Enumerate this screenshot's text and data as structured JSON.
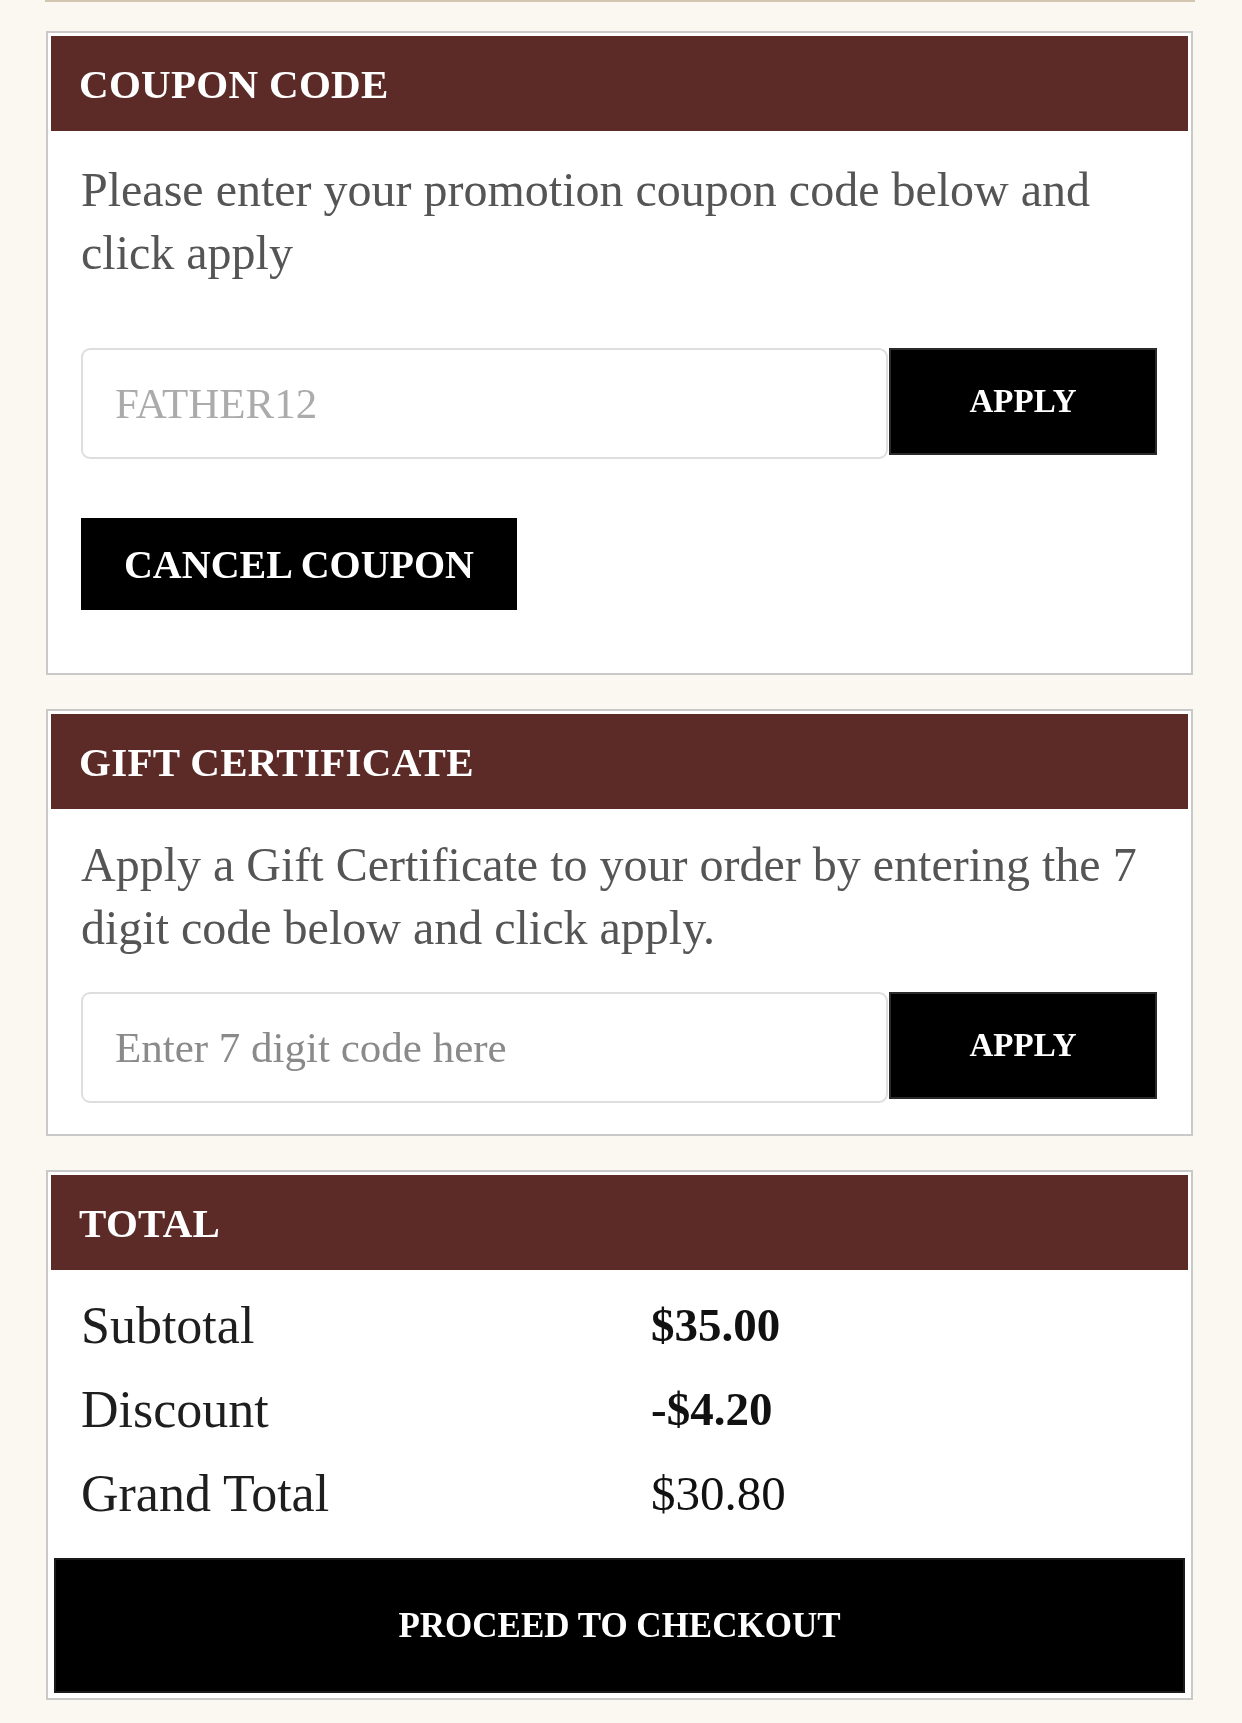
{
  "coupon_code": {
    "title": "COUPON CODE",
    "text": "Please enter your promotion coupon code below and click apply",
    "input": {
      "value": "FATHER12",
      "disabled": true
    },
    "apply_button": "APPLY",
    "cancel_button": "CANCEL COUPON"
  },
  "gift_certificate": {
    "title": "GIFT CERTIFICATE",
    "text": "Apply a Gift Certificate to your order by entering the 7 digit code below and click apply.",
    "input": {
      "placeholder": "Enter 7 digit code here"
    },
    "apply_button": "APPLY"
  },
  "total": {
    "title": "TOTAL",
    "rows": [
      {
        "label": "Subtotal",
        "value": "$35.00",
        "bold": true
      },
      {
        "label": "Discount",
        "value": "-$4.20",
        "bold": true
      },
      {
        "label": "Grand Total",
        "value": "$30.80",
        "bold": false
      }
    ],
    "checkout_button": "PROCEED TO CHECKOUT"
  }
}
